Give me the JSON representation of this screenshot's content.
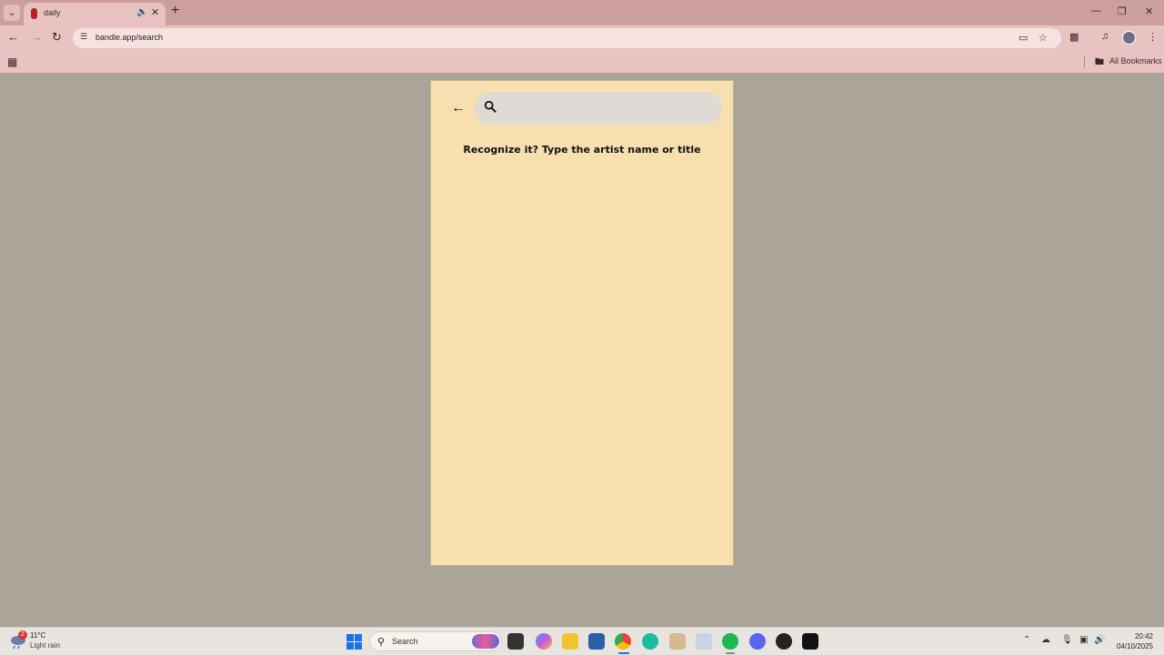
{
  "browser": {
    "tab": {
      "title": "daily"
    },
    "url": "bandle.app/search",
    "bookmarks_label": "All Bookmarks"
  },
  "app": {
    "search": {
      "placeholder": ""
    },
    "prompt": "Recognize it? Type the artist name or title"
  },
  "taskbar": {
    "weather": {
      "badge": "2",
      "temp": "11°C",
      "condition": "Light rain"
    },
    "search_label": "Search",
    "clock": {
      "time": "20:42",
      "date": "04/10/2025"
    }
  },
  "colors": {
    "page_bg": "#aba498",
    "panel_bg": "#f7dfb0",
    "chrome_tab_strip": "#cd9e9e",
    "chrome_toolbar": "#e9c2c2"
  }
}
